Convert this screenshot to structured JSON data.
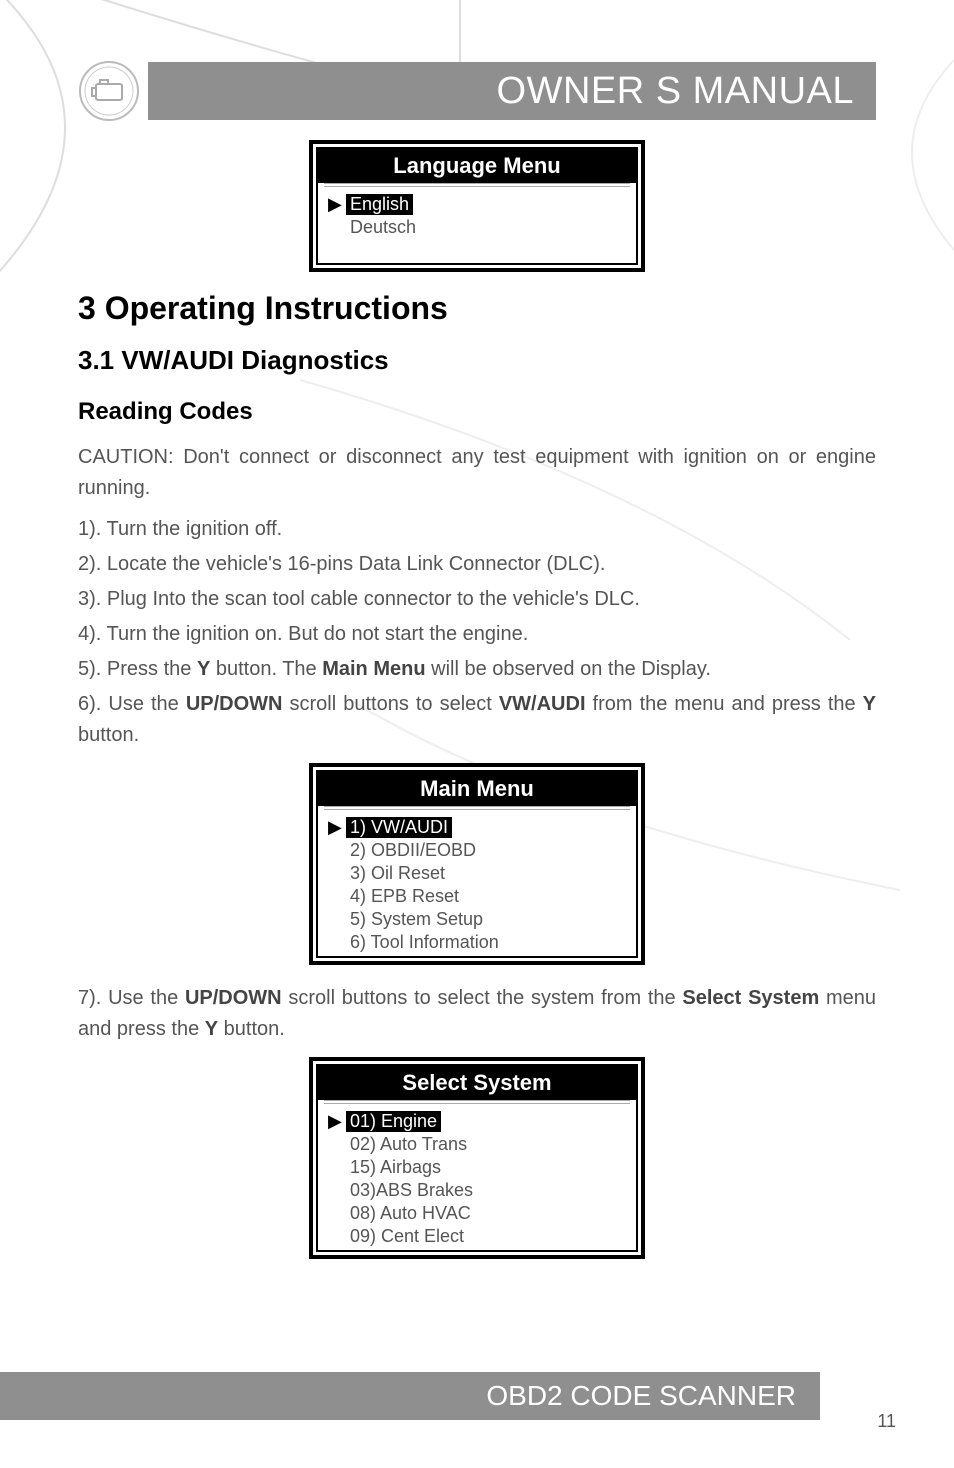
{
  "header": {
    "title": "OWNER S MANUAL"
  },
  "language_menu": {
    "title": "Language Menu",
    "items": [
      {
        "label": "English",
        "selected": true
      },
      {
        "label": "Deutsch",
        "selected": false
      }
    ]
  },
  "section": {
    "heading": "3 Operating Instructions",
    "sub": "3.1  VW/AUDI Diagnostics",
    "subsub": "Reading Codes",
    "caution": "CAUTION: Don't connect or disconnect any test equipment with ignition on or engine running.",
    "steps": {
      "s1": "1). Turn the ignition off.",
      "s2": "2). Locate the vehicle's 16-pins Data Link Connector (DLC).",
      "s3": "3). Plug Into the scan tool cable connector to the vehicle's DLC.",
      "s4": "4). Turn the ignition on. But do not start the engine.",
      "s5a": "5). Press the ",
      "s5b": "Y",
      "s5c": " button. The ",
      "s5d": "Main Menu",
      "s5e": " will be observed on the Display.",
      "s6a": "6). Use the ",
      "s6b": "UP/DOWN",
      "s6c": " scroll buttons to select ",
      "s6d": "VW/AUDI",
      "s6e": " from the menu and press the ",
      "s6f": "Y",
      "s6g": " button.",
      "s7a": "7). Use the ",
      "s7b": "UP/DOWN",
      "s7c": " scroll buttons to select the system from the ",
      "s7d": "Select System",
      "s7e": " menu and press the ",
      "s7f": "Y",
      "s7g": " button."
    }
  },
  "main_menu": {
    "title": "Main  Menu",
    "items": [
      {
        "label": "1)  VW/AUDI",
        "selected": true
      },
      {
        "label": "2) OBDII/EOBD",
        "selected": false
      },
      {
        "label": "3) Oil Reset",
        "selected": false
      },
      {
        "label": "4) EPB Reset",
        "selected": false
      },
      {
        "label": "5) System Setup",
        "selected": false
      },
      {
        "label": "6) Tool Information",
        "selected": false
      }
    ]
  },
  "select_system": {
    "title": "Select System",
    "items": [
      {
        "label": "01)  Engine",
        "selected": true
      },
      {
        "label": "02)  Auto Trans",
        "selected": false
      },
      {
        "label": "15)  Airbags",
        "selected": false
      },
      {
        "label": "03)ABS Brakes",
        "selected": false
      },
      {
        "label": "08)  Auto HVAC",
        "selected": false
      },
      {
        "label": "09)  Cent Elect",
        "selected": false
      }
    ]
  },
  "footer": {
    "label": "OBD2 CODE SCANNER"
  },
  "page_number": "11"
}
